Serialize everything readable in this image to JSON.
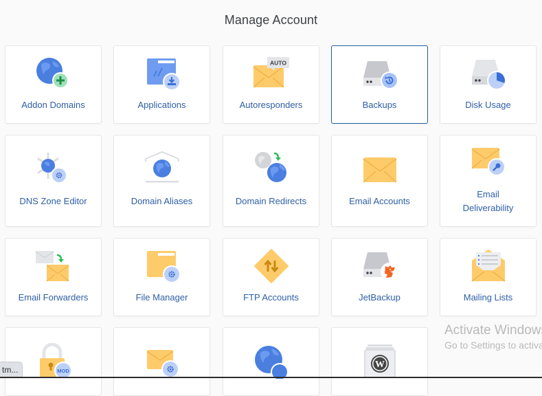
{
  "page": {
    "title": "Manage Account"
  },
  "colors": {
    "label": "#2d5fa6",
    "selected_border": "#1f5f9e",
    "globe_blue": "#4a7fe0",
    "envelope_yellow": "#fecb6b",
    "badge_blue": "#bcd0f7",
    "green": "#2ebd59",
    "jetbackup_orange": "#f26522"
  },
  "tiles": [
    {
      "label": "Addon Domains",
      "icon": "globe-plus-icon",
      "selected": false
    },
    {
      "label": "Applications",
      "icon": "app-folder-download-icon",
      "selected": false
    },
    {
      "label": "Autoresponders",
      "icon": "envelope-auto-icon",
      "badge": "AUTO",
      "selected": false
    },
    {
      "label": "Backups",
      "icon": "drive-restore-icon",
      "selected": true
    },
    {
      "label": "Disk Usage",
      "icon": "drive-pie-icon",
      "selected": false
    },
    {
      "label": "DNS Zone Editor",
      "icon": "dns-globe-gear-icon",
      "selected": false
    },
    {
      "label": "Domain Aliases",
      "icon": "globe-house-icon",
      "selected": false
    },
    {
      "label": "Domain Redirects",
      "icon": "globe-redirect-icon",
      "selected": false
    },
    {
      "label": "Email Accounts",
      "icon": "envelope-icon",
      "selected": false
    },
    {
      "label_line1": "Email",
      "label_line2": "Deliverability",
      "icon": "envelope-key-icon",
      "selected": false
    },
    {
      "label": "Email Forwarders",
      "icon": "envelope-forward-icon",
      "selected": false
    },
    {
      "label": "File Manager",
      "icon": "folder-gear-icon",
      "selected": false
    },
    {
      "label": "FTP Accounts",
      "icon": "ftp-diamond-arrows-icon",
      "selected": false
    },
    {
      "label": "JetBackup",
      "icon": "drive-jetbackup-icon",
      "selected": false
    },
    {
      "label": "Mailing Lists",
      "icon": "envelope-list-icon",
      "selected": false
    },
    {
      "label": "",
      "icon": "lock-mod-icon",
      "badge": "MOD",
      "selected": false
    },
    {
      "label": "",
      "icon": "envelope-gear-icon",
      "selected": false
    },
    {
      "label": "",
      "icon": "globe-globe-icon",
      "selected": false
    },
    {
      "label": "",
      "icon": "wordpress-icon",
      "selected": false
    }
  ],
  "overlay": {
    "watermark_line1": "Activate Windows",
    "watermark_line2": "Go to Settings to activate Windows.",
    "tooltip_text": "tm..."
  }
}
